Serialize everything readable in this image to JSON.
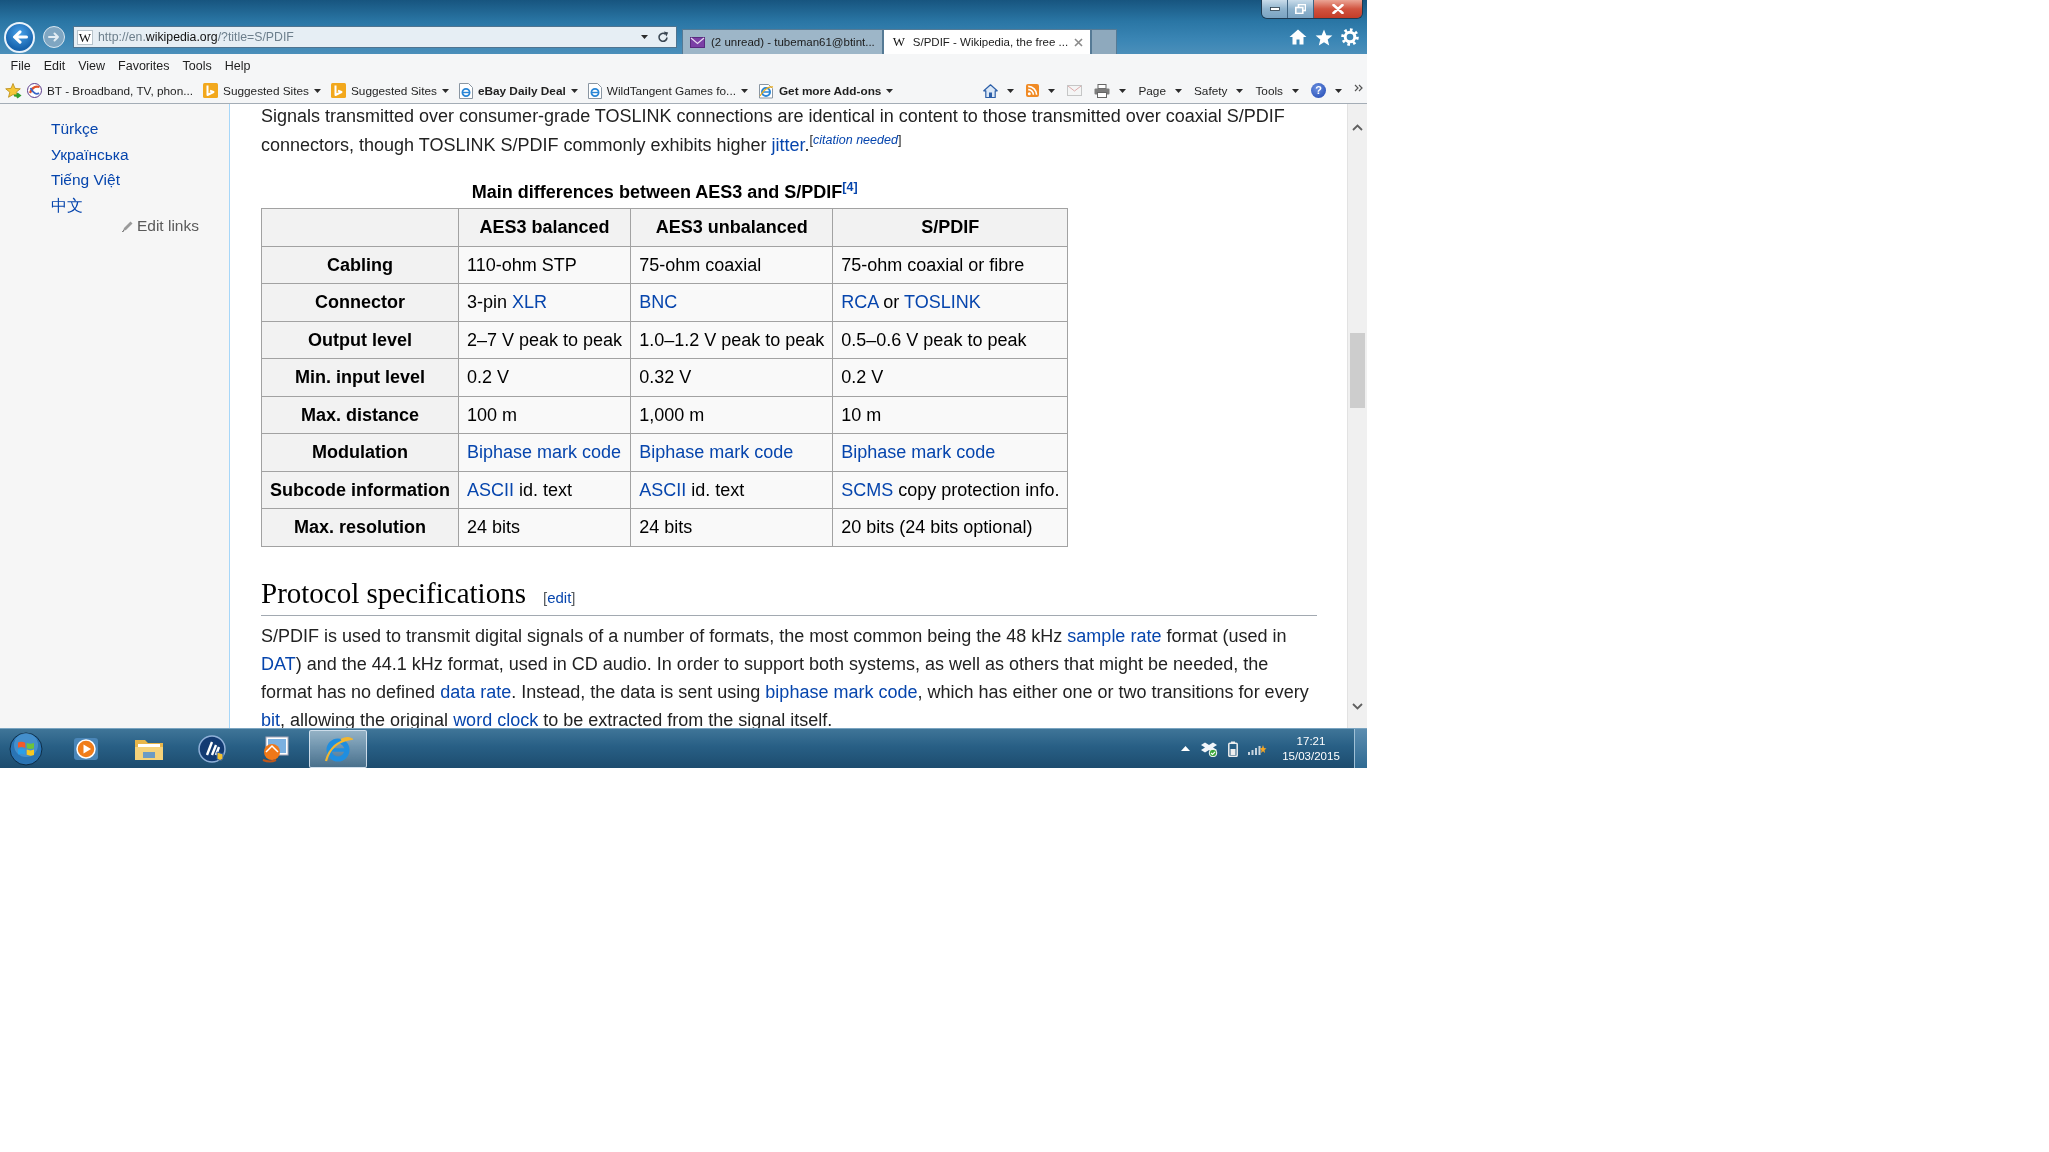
{
  "browser": {
    "address": {
      "favicon": "W",
      "url": "http://en.**wikipedia.org**/?title=S/PDIF"
    },
    "tabs": [
      {
        "kind": "mail",
        "label": "(2 unread) - tubeman61@btint...",
        "selected": false
      },
      {
        "kind": "site",
        "favicon": "W",
        "label": "S/PDIF - Wikipedia, the free ...",
        "selected": true
      }
    ],
    "menu": [
      "File",
      "Edit",
      "View",
      "Favorites",
      "Tools",
      "Help"
    ],
    "favorites": [
      {
        "kind": "site",
        "label": "BT - Broadband, TV, phon...",
        "dropdown": false
      },
      {
        "kind": "suggested",
        "label": "Suggested Sites",
        "dropdown": true
      },
      {
        "kind": "suggested",
        "label": "Suggested Sites",
        "dropdown": true
      },
      {
        "kind": "slice",
        "label": "eBay Daily Deal",
        "dropdown": true
      },
      {
        "kind": "page",
        "label": "WildTangent Games fo...",
        "dropdown": true
      },
      {
        "kind": "gallery",
        "label": "Get more Add-ons",
        "dropdown": true
      }
    ],
    "commands": [
      {
        "kind": "home",
        "dropdown": true,
        "disabled": false
      },
      {
        "kind": "feeds",
        "dropdown": true,
        "disabled": false
      },
      {
        "kind": "mail",
        "dropdown": false,
        "disabled": true
      },
      {
        "kind": "print",
        "dropdown": true,
        "disabled": false
      },
      {
        "kind": "menu",
        "label": "Page",
        "dropdown": true,
        "disabled": false
      },
      {
        "kind": "menu",
        "label": "Safety",
        "dropdown": true,
        "disabled": false
      },
      {
        "kind": "menu",
        "label": "Tools",
        "dropdown": true,
        "disabled": false
      },
      {
        "kind": "help",
        "symbol": "?",
        "dropdown": true,
        "disabled": false
      }
    ]
  },
  "sidebar": {
    "languages": [
      "Türkçe",
      "Українська",
      "Tiếng Việt",
      "中文"
    ],
    "edit_links": "Edit links"
  },
  "article": {
    "intro": [
      {
        "kind": "text",
        "text": "Signals transmitted over consumer-grade TOSLINK connections are identical in content to those transmitted over coaxial S/PDIF connectors, though TOSLINK S/PDIF commonly exhibits higher "
      },
      {
        "kind": "link",
        "text": "jitter"
      },
      {
        "kind": "text",
        "text": "."
      },
      {
        "kind": "note",
        "parts": [
          {
            "kind": "bracket",
            "text": "["
          },
          {
            "kind": "link",
            "text": "*citation needed*"
          },
          {
            "kind": "bracket",
            "text": "]"
          }
        ]
      }
    ],
    "table": {
      "caption": [
        {
          "kind": "text",
          "text": "Main differences between AES3 and S/PDIF"
        },
        {
          "kind": "ref",
          "parts": [
            {
              "kind": "link",
              "text": "[4]"
            }
          ]
        }
      ],
      "columns": [
        "AES3 balanced",
        "AES3 unbalanced",
        "S/PDIF"
      ],
      "rows": [
        {
          "label": "Cabling",
          "cells": [
            [
              {
                "kind": "text",
                "text": "110-ohm STP"
              }
            ],
            [
              {
                "kind": "text",
                "text": "75-ohm coaxial"
              }
            ],
            [
              {
                "kind": "text",
                "text": "75-ohm coaxial or fibre"
              }
            ]
          ]
        },
        {
          "label": "Connector",
          "cells": [
            [
              {
                "kind": "text",
                "text": "3-pin "
              },
              {
                "kind": "link",
                "text": "XLR"
              }
            ],
            [
              {
                "kind": "link",
                "text": "BNC"
              }
            ],
            [
              {
                "kind": "link",
                "text": "RCA"
              },
              {
                "kind": "text",
                "text": " or "
              },
              {
                "kind": "link",
                "text": "TOSLINK"
              }
            ]
          ]
        },
        {
          "label": "Output level",
          "cells": [
            [
              {
                "kind": "text",
                "text": "2–7 V peak to peak"
              }
            ],
            [
              {
                "kind": "text",
                "text": "1.0–1.2 V peak to peak"
              }
            ],
            [
              {
                "kind": "text",
                "text": "0.5–0.6 V peak to peak"
              }
            ]
          ]
        },
        {
          "label": "Min. input level",
          "cells": [
            [
              {
                "kind": "text",
                "text": "0.2 V"
              }
            ],
            [
              {
                "kind": "text",
                "text": "0.32 V"
              }
            ],
            [
              {
                "kind": "text",
                "text": "0.2 V"
              }
            ]
          ]
        },
        {
          "label": "Max. distance",
          "cells": [
            [
              {
                "kind": "text",
                "text": "100 m"
              }
            ],
            [
              {
                "kind": "text",
                "text": "1,000 m"
              }
            ],
            [
              {
                "kind": "text",
                "text": "10 m"
              }
            ]
          ]
        },
        {
          "label": "Modulation",
          "cells": [
            [
              {
                "kind": "link",
                "text": "Biphase mark code"
              }
            ],
            [
              {
                "kind": "link",
                "text": "Biphase mark code"
              }
            ],
            [
              {
                "kind": "link",
                "text": "Biphase mark code"
              }
            ]
          ]
        },
        {
          "label": "Subcode information",
          "cells": [
            [
              {
                "kind": "link",
                "text": "ASCII"
              },
              {
                "kind": "text",
                "text": " id. text"
              }
            ],
            [
              {
                "kind": "link",
                "text": "ASCII"
              },
              {
                "kind": "text",
                "text": " id. text"
              }
            ],
            [
              {
                "kind": "link",
                "text": "SCMS"
              },
              {
                "kind": "text",
                "text": " copy protection info."
              }
            ]
          ]
        },
        {
          "label": "Max. resolution",
          "cells": [
            [
              {
                "kind": "text",
                "text": "24 bits"
              }
            ],
            [
              {
                "kind": "text",
                "text": "24 bits"
              }
            ],
            [
              {
                "kind": "text",
                "text": "20 bits (24 bits optional)"
              }
            ]
          ]
        }
      ]
    },
    "section": {
      "title": "Protocol specifications",
      "edit": [
        {
          "kind": "bracket",
          "text": "["
        },
        {
          "kind": "link",
          "text": "edit"
        },
        {
          "kind": "bracket",
          "text": "]"
        }
      ],
      "paragraph": [
        {
          "kind": "text",
          "text": "S/PDIF is used to transmit digital signals of a number of formats, the most common being the 48 kHz "
        },
        {
          "kind": "link",
          "text": "sample rate"
        },
        {
          "kind": "text",
          "text": " format (used in "
        },
        {
          "kind": "link",
          "text": "DAT"
        },
        {
          "kind": "text",
          "text": ") and the 44.1 kHz format, used in CD audio. In order to support both systems, as well as others that might be needed, the format has no defined "
        },
        {
          "kind": "link",
          "text": "data rate"
        },
        {
          "kind": "text",
          "text": ". Instead, the data is sent using "
        },
        {
          "kind": "link",
          "text": "biphase mark code"
        },
        {
          "kind": "text",
          "text": ", which has either one or two transitions for every "
        },
        {
          "kind": "link",
          "text": "bit"
        },
        {
          "kind": "text",
          "text": ", allowing the original "
        },
        {
          "kind": "link",
          "text": "word clock"
        },
        {
          "kind": "text",
          "text": " to be extracted from the signal itself."
        }
      ]
    }
  },
  "taskbar": {
    "apps": [
      {
        "kind": "media",
        "selected": false
      },
      {
        "kind": "folder",
        "selected": false
      },
      {
        "kind": "utility",
        "selected": false
      },
      {
        "kind": "photos",
        "selected": false
      },
      {
        "kind": "browser",
        "selected": true
      }
    ],
    "clock": {
      "time": "17:21",
      "date": "15/03/2015"
    }
  }
}
